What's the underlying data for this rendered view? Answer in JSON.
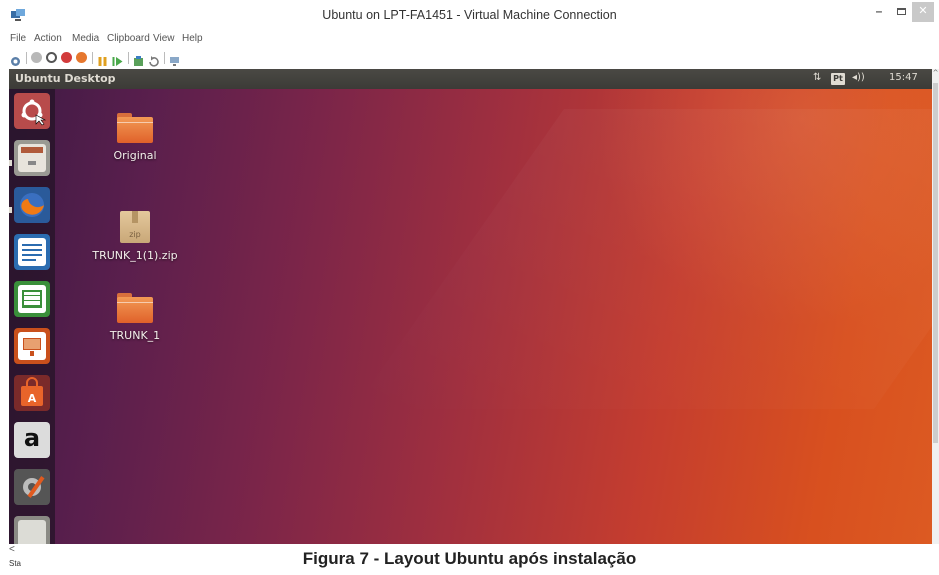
{
  "window": {
    "title": "Ubuntu on LPT-FA1451 - Virtual Machine Connection",
    "minimize": "–",
    "close": "✕"
  },
  "menu": {
    "items": [
      "File",
      "Action",
      "Media",
      "Clipboard",
      "View",
      "Help"
    ]
  },
  "toolbar": {
    "icons": [
      "ctrl-alt-del-icon",
      "start-icon",
      "turn-off-icon",
      "shut-down-icon",
      "save-icon",
      "pause-icon",
      "resume-icon",
      "checkpoint-icon",
      "revert-icon",
      "enhanced-session-icon"
    ]
  },
  "vm": {
    "panel_title": "Ubuntu Desktop",
    "indicators": {
      "network": "⇅",
      "keyboard": "Pt",
      "volume": "◂))",
      "clock": "15:47"
    },
    "launcher": [
      {
        "name": "dash-home",
        "color": "#b84b4b"
      },
      {
        "name": "files",
        "color": "#8b8b85"
      },
      {
        "name": "firefox",
        "color": "#e66000"
      },
      {
        "name": "libreoffice-writer",
        "color": "#2b6cb0"
      },
      {
        "name": "libreoffice-calc",
        "color": "#3a8f3a"
      },
      {
        "name": "libreoffice-impress",
        "color": "#c9501c"
      },
      {
        "name": "ubuntu-software",
        "color": "#e05a1f"
      },
      {
        "name": "amazon",
        "color": "#d8d8d8"
      },
      {
        "name": "system-settings",
        "color": "#6a6a6a"
      },
      {
        "name": "terminal",
        "color": "#7a7a7a"
      }
    ],
    "amazon_letter": "a",
    "desktop_icons": [
      {
        "label": "Original",
        "kind": "folder"
      },
      {
        "label": "TRUNK_1(1).zip",
        "kind": "zip",
        "badge": "zip"
      },
      {
        "label": "TRUNK_1",
        "kind": "folder"
      }
    ]
  },
  "scroll_arrow": "^",
  "bottom_left": "<",
  "status_left": "Sta",
  "caption": "Figura 7 - Layout Ubuntu após instalação"
}
